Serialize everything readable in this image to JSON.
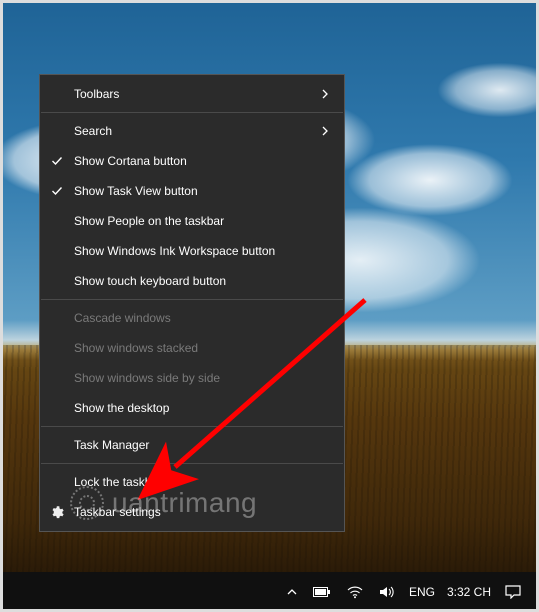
{
  "contextMenu": {
    "items": {
      "toolbars": {
        "label": "Toolbars",
        "submenu": true
      },
      "search": {
        "label": "Search",
        "submenu": true
      },
      "cortana": {
        "label": "Show Cortana button",
        "checked": true
      },
      "taskview": {
        "label": "Show Task View button",
        "checked": true
      },
      "people": {
        "label": "Show People on the taskbar"
      },
      "ink": {
        "label": "Show Windows Ink Workspace button"
      },
      "touchkb": {
        "label": "Show touch keyboard button"
      },
      "cascade": {
        "label": "Cascade windows",
        "disabled": true
      },
      "stacked": {
        "label": "Show windows stacked",
        "disabled": true
      },
      "sidebyside": {
        "label": "Show windows side by side",
        "disabled": true
      },
      "showdesktop": {
        "label": "Show the desktop"
      },
      "taskmanager": {
        "label": "Task Manager"
      },
      "lock": {
        "label": "Lock the taskbar"
      },
      "settings": {
        "label": "Taskbar settings",
        "icon": "gear"
      }
    }
  },
  "taskbar": {
    "ime": "ENG",
    "clock": "3:32 CH"
  },
  "watermark": {
    "text": "uantrimang"
  },
  "colors": {
    "menuBg": "#2b2b2b",
    "menuBorder": "#555555",
    "menuText": "#ffffff",
    "menuDisabled": "#7a7a7a",
    "arrow": "#ff0000",
    "taskbar": "#101010"
  }
}
